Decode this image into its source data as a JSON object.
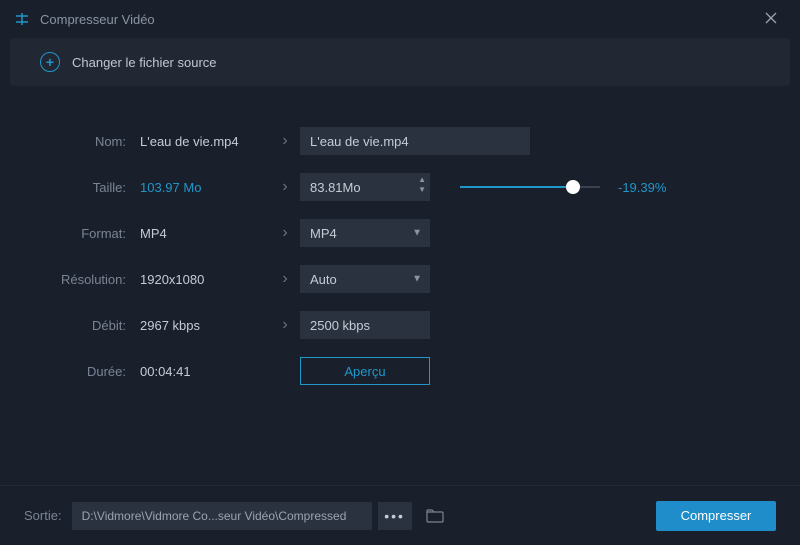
{
  "titlebar": {
    "title": "Compresseur Vidéo"
  },
  "source": {
    "change_label": "Changer le fichier source"
  },
  "fields": {
    "name": {
      "label": "Nom:",
      "source": "L'eau de vie.mp4",
      "target": "L'eau de vie.mp4"
    },
    "size": {
      "label": "Taille:",
      "source": "103.97 Mo",
      "target": "83.81Mo",
      "percent": "-19.39%"
    },
    "format": {
      "label": "Format:",
      "source": "MP4",
      "target": "MP4"
    },
    "resolution": {
      "label": "Résolution:",
      "source": "1920x1080",
      "target": "Auto"
    },
    "bitrate": {
      "label": "Débit:",
      "source": "2967 kbps",
      "target": "2500 kbps"
    },
    "duration": {
      "label": "Durée:",
      "source": "00:04:41"
    },
    "preview_label": "Aperçu"
  },
  "footer": {
    "output_label": "Sortie:",
    "path": "D:\\Vidmore\\Vidmore Co...seur Vidéo\\Compressed",
    "compress_label": "Compresser"
  }
}
